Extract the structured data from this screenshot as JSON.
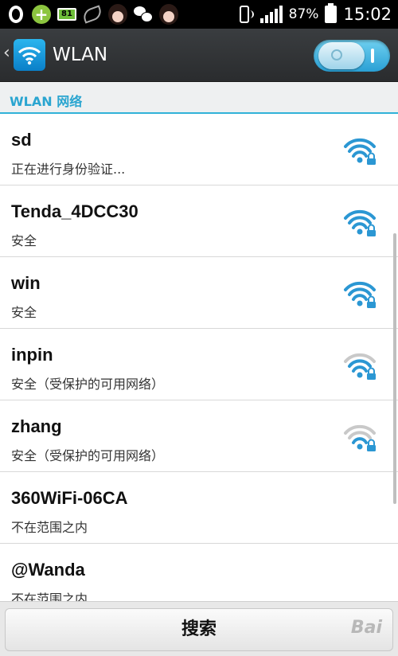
{
  "status_bar": {
    "battery_percent": "87%",
    "time": "15:02",
    "battery_level_small": "81"
  },
  "action_bar": {
    "back": "‹",
    "title": "WLAN",
    "switch_state": "on"
  },
  "section": {
    "label": "WLAN 网络"
  },
  "networks": [
    {
      "ssid": "sd",
      "status": "正在进行身份验证...",
      "secured": true,
      "signal": 4
    },
    {
      "ssid": "Tenda_4DCC30",
      "status": "安全",
      "secured": true,
      "signal": 4
    },
    {
      "ssid": "win",
      "status": "安全",
      "secured": true,
      "signal": 4
    },
    {
      "ssid": "inpin",
      "status": "安全（受保护的可用网络）",
      "secured": true,
      "signal": 3
    },
    {
      "ssid": "zhang",
      "status": "安全（受保护的可用网络）",
      "secured": true,
      "signal": 2
    },
    {
      "ssid": "360WiFi-06CA",
      "status": "不在范围之内",
      "secured": false,
      "signal": 0
    },
    {
      "ssid": "@Wanda",
      "status": "不在范围之内",
      "secured": false,
      "signal": 0
    }
  ],
  "bottom": {
    "search_label": "搜索",
    "watermark": "Bai"
  },
  "colors": {
    "accent": "#31b2d8",
    "signal_active": "#2b97d3",
    "signal_inactive": "#c9c9c9"
  }
}
